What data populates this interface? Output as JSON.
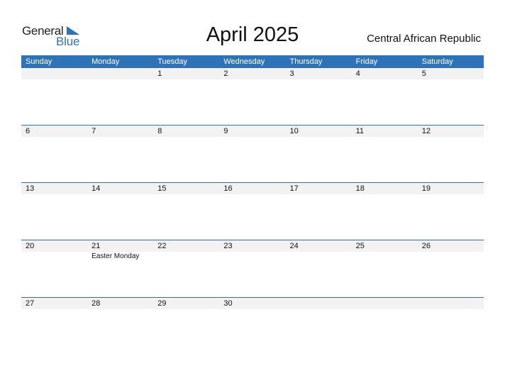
{
  "logo": {
    "general": "General",
    "blue": "Blue"
  },
  "title": "April 2025",
  "country": "Central African Republic",
  "colors": {
    "accent": "#2e73b8",
    "strip": "#f2f2f2"
  },
  "weekdays": [
    "Sunday",
    "Monday",
    "Tuesday",
    "Wednesday",
    "Thursday",
    "Friday",
    "Saturday"
  ],
  "weeks": [
    [
      {
        "d": ""
      },
      {
        "d": ""
      },
      {
        "d": "1"
      },
      {
        "d": "2"
      },
      {
        "d": "3"
      },
      {
        "d": "4"
      },
      {
        "d": "5"
      }
    ],
    [
      {
        "d": "6"
      },
      {
        "d": "7"
      },
      {
        "d": "8"
      },
      {
        "d": "9"
      },
      {
        "d": "10"
      },
      {
        "d": "11"
      },
      {
        "d": "12"
      }
    ],
    [
      {
        "d": "13"
      },
      {
        "d": "14"
      },
      {
        "d": "15"
      },
      {
        "d": "16"
      },
      {
        "d": "17"
      },
      {
        "d": "18"
      },
      {
        "d": "19"
      }
    ],
    [
      {
        "d": "20"
      },
      {
        "d": "21",
        "h": "Easter Monday"
      },
      {
        "d": "22"
      },
      {
        "d": "23"
      },
      {
        "d": "24"
      },
      {
        "d": "25"
      },
      {
        "d": "26"
      }
    ],
    [
      {
        "d": "27"
      },
      {
        "d": "28"
      },
      {
        "d": "29"
      },
      {
        "d": "30"
      },
      {
        "d": ""
      },
      {
        "d": ""
      },
      {
        "d": ""
      }
    ]
  ]
}
